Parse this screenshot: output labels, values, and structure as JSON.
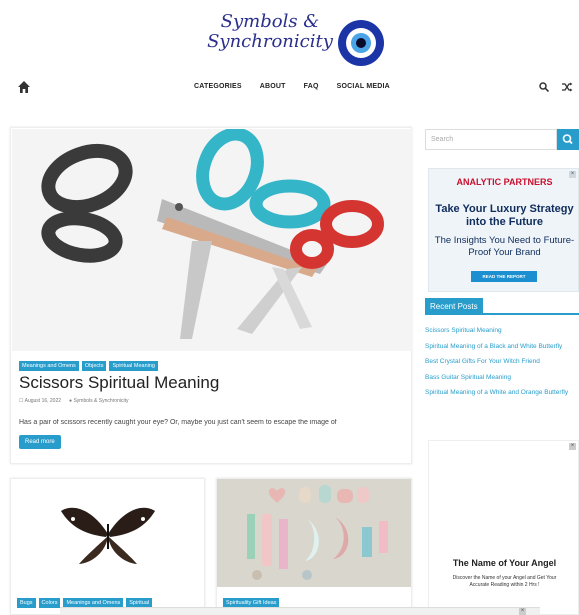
{
  "site": {
    "logo_text": "Symbols & Synchronicity",
    "logo_icon": "evil-eye-icon"
  },
  "nav": {
    "items": [
      "CATEGORIES",
      "ABOUT",
      "FAQ",
      "SOCIAL MEDIA"
    ]
  },
  "featured": {
    "categories": [
      "Meanings and Omens",
      "Objects",
      "Spiritual Meaning"
    ],
    "title": "Scissors Spiritual Meaning",
    "date": "August 16, 2022",
    "author": "Symbols & Synchronicity",
    "excerpt": "Has a pair of scissors recently caught your eye? Or, maybe you just can't seem to escape the image of",
    "read_more": "Read more"
  },
  "small_posts": [
    {
      "categories": [
        "Bugs",
        "Colors",
        "Meanings and Omens",
        "Spiritual"
      ]
    },
    {
      "categories": [
        "Spirituality Gift Ideas"
      ]
    }
  ],
  "sidebar": {
    "search_placeholder": "Search",
    "ad1": {
      "brand": "ANALYTIC PARTNERS",
      "headline": "Take Your Luxury Strategy into the Future",
      "sub": "The Insights You Need to Future-Proof Your Brand",
      "button": "READ THE REPORT"
    },
    "recent_title": "Recent Posts",
    "recent": [
      "Scissors Spiritual Meaning",
      "Spiritual Meaning of a Black and White Butterfly",
      "Best Crystal Gifts For Your Witch Friend",
      "Bass Guitar Spiritual Meaning",
      "Spiritual Meaning of a White and Orange Butterfly"
    ],
    "ad2": {
      "title": "The Name of Your Angel",
      "text": "Discover the Name of your Angel and Get Your Accurate Reading within 2 Hrs !"
    }
  },
  "colors": {
    "accent": "#289dcc"
  }
}
